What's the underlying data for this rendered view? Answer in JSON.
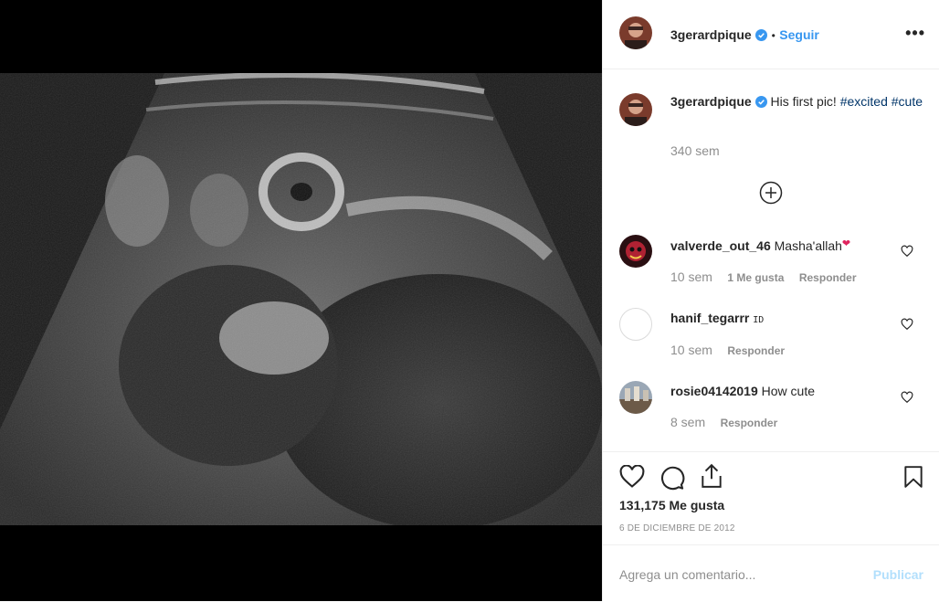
{
  "post": {
    "username": "3gerardpique",
    "separator": "•",
    "follow_label": "Seguir",
    "more_label": "•••"
  },
  "caption": {
    "username": "3gerardpique",
    "text": "His first pic!",
    "tag1": "#excited",
    "tag2": "#cute",
    "time": "340 sem"
  },
  "load_more": {
    "label": "⊕"
  },
  "comments": [
    {
      "username": "valverde_out_46",
      "text": "Masha'allah",
      "time": "10 sem",
      "likes": "1 Me gusta",
      "reply": "Responder"
    },
    {
      "username": "hanif_tegarrr",
      "text": "ID",
      "time": "10 sem",
      "reply": "Responder"
    },
    {
      "username": "rosie04142019",
      "text": "How cute",
      "time": "8 sem",
      "reply": "Responder"
    }
  ],
  "likes_label": "131,175 Me gusta",
  "date_label": "6 DE DICIEMBRE DE 2012",
  "add_comment": {
    "placeholder": "Agrega un comentario...",
    "publish": "Publicar"
  },
  "colors": {
    "link": "#3897f0",
    "hashtag": "#003569",
    "muted": "#8e8e8e",
    "publish_disabled": "#b2dffc"
  }
}
